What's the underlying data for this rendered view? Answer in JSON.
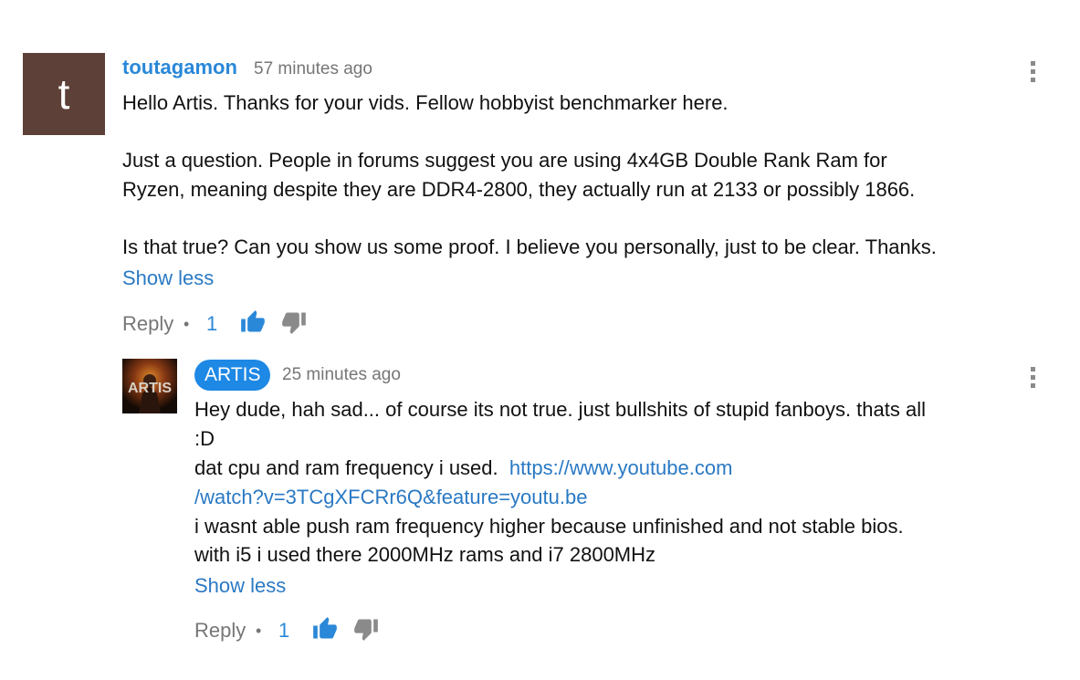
{
  "comment": {
    "avatar_letter": "t",
    "author": "toutagamon",
    "timestamp": "57 minutes ago",
    "lines": [
      "Hello Artis. Thanks for your vids. Fellow hobbyist benchmarker here.",
      "Just a question. People in forums suggest you are using 4x4GB Double Rank Ram for",
      "Ryzen, meaning despite they are DDR4-2800, they actually run at 2133 or possibly 1866.",
      "Is that true? Can you show us some proof. I believe you personally, just to be clear. Thanks."
    ],
    "show_less": "Show less",
    "reply_label": "Reply",
    "separator": "•",
    "like_count": "1"
  },
  "reply": {
    "avatar_text": "ARTIS",
    "author": "ARTIS",
    "timestamp": "25 minutes ago",
    "line1": "Hey dude, hah sad... of course its not true. just bullshits of stupid fanboys. thats all",
    "line2": ":D",
    "line3_text": "dat cpu and ram frequency i used.  ",
    "link_part1": "https://www.youtube.com",
    "link_part2": "/watch?v=3TCgXFCRr6Q&feature=youtu.be",
    "line5": "i wasnt able push ram frequency higher because unfinished and not stable bios.",
    "line6": "with i5 i used there 2000MHz rams and i7 2800MHz",
    "show_less": "Show less",
    "reply_label": "Reply",
    "separator": "•",
    "like_count": "1"
  },
  "colors": {
    "author_blue": "#2a88d8",
    "link_blue": "#2a79c3",
    "owner_badge": "#1e88e5",
    "avatar_brown": "#5d4037",
    "muted_gray": "#767676"
  },
  "icons": {
    "like": "thumbs-up-icon",
    "dislike": "thumbs-down-icon",
    "menu": "more-vert-icon"
  }
}
